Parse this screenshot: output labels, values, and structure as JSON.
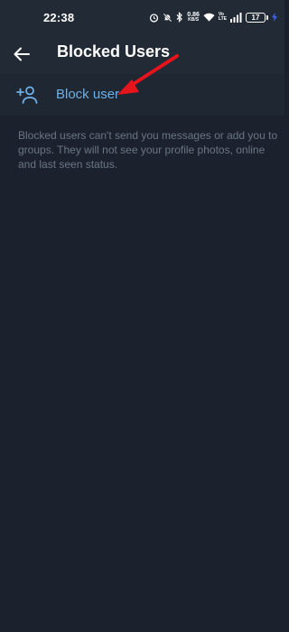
{
  "status_bar": {
    "time": "22:38",
    "net_speed_value": "0.86",
    "net_speed_unit": "KB/S",
    "volte_top": "Vo",
    "volte_bottom": "LTE",
    "battery": "17"
  },
  "toolbar": {
    "title": "Blocked Users"
  },
  "block_row": {
    "label": "Block user"
  },
  "info": {
    "text": "Blocked users can't send you messages or add you to groups. They will not see your profile photos, online and last seen status."
  },
  "colors": {
    "background": "#1b222d",
    "toolbar": "#222a36",
    "accent": "#6fb0e6",
    "annotation_arrow": "#e8141c"
  }
}
